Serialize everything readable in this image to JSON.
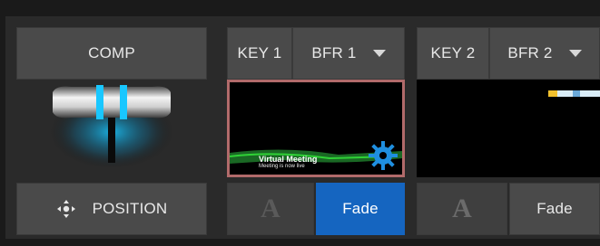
{
  "left_column": {
    "comp_label": "COMP",
    "position_label": "POSITION"
  },
  "key1": {
    "key_label": "KEY 1",
    "buffer_label": "BFR 1",
    "preview_title": "Virtual Meeting",
    "preview_subtitle": "Meeting is now live",
    "transition_label": "Fade",
    "transition_active": true
  },
  "key2": {
    "key_label": "KEY 2",
    "buffer_label": "BFR 2",
    "transition_label": "Fade",
    "transition_active": false
  },
  "colors": {
    "accent_blue": "#1565c0",
    "preview_border": "#b16a6a",
    "tbar_cyan": "#19c7ff"
  },
  "icons": [
    "move-arrows-icon",
    "dropdown-caret-icon",
    "gear-icon",
    "text-a-icon"
  ]
}
